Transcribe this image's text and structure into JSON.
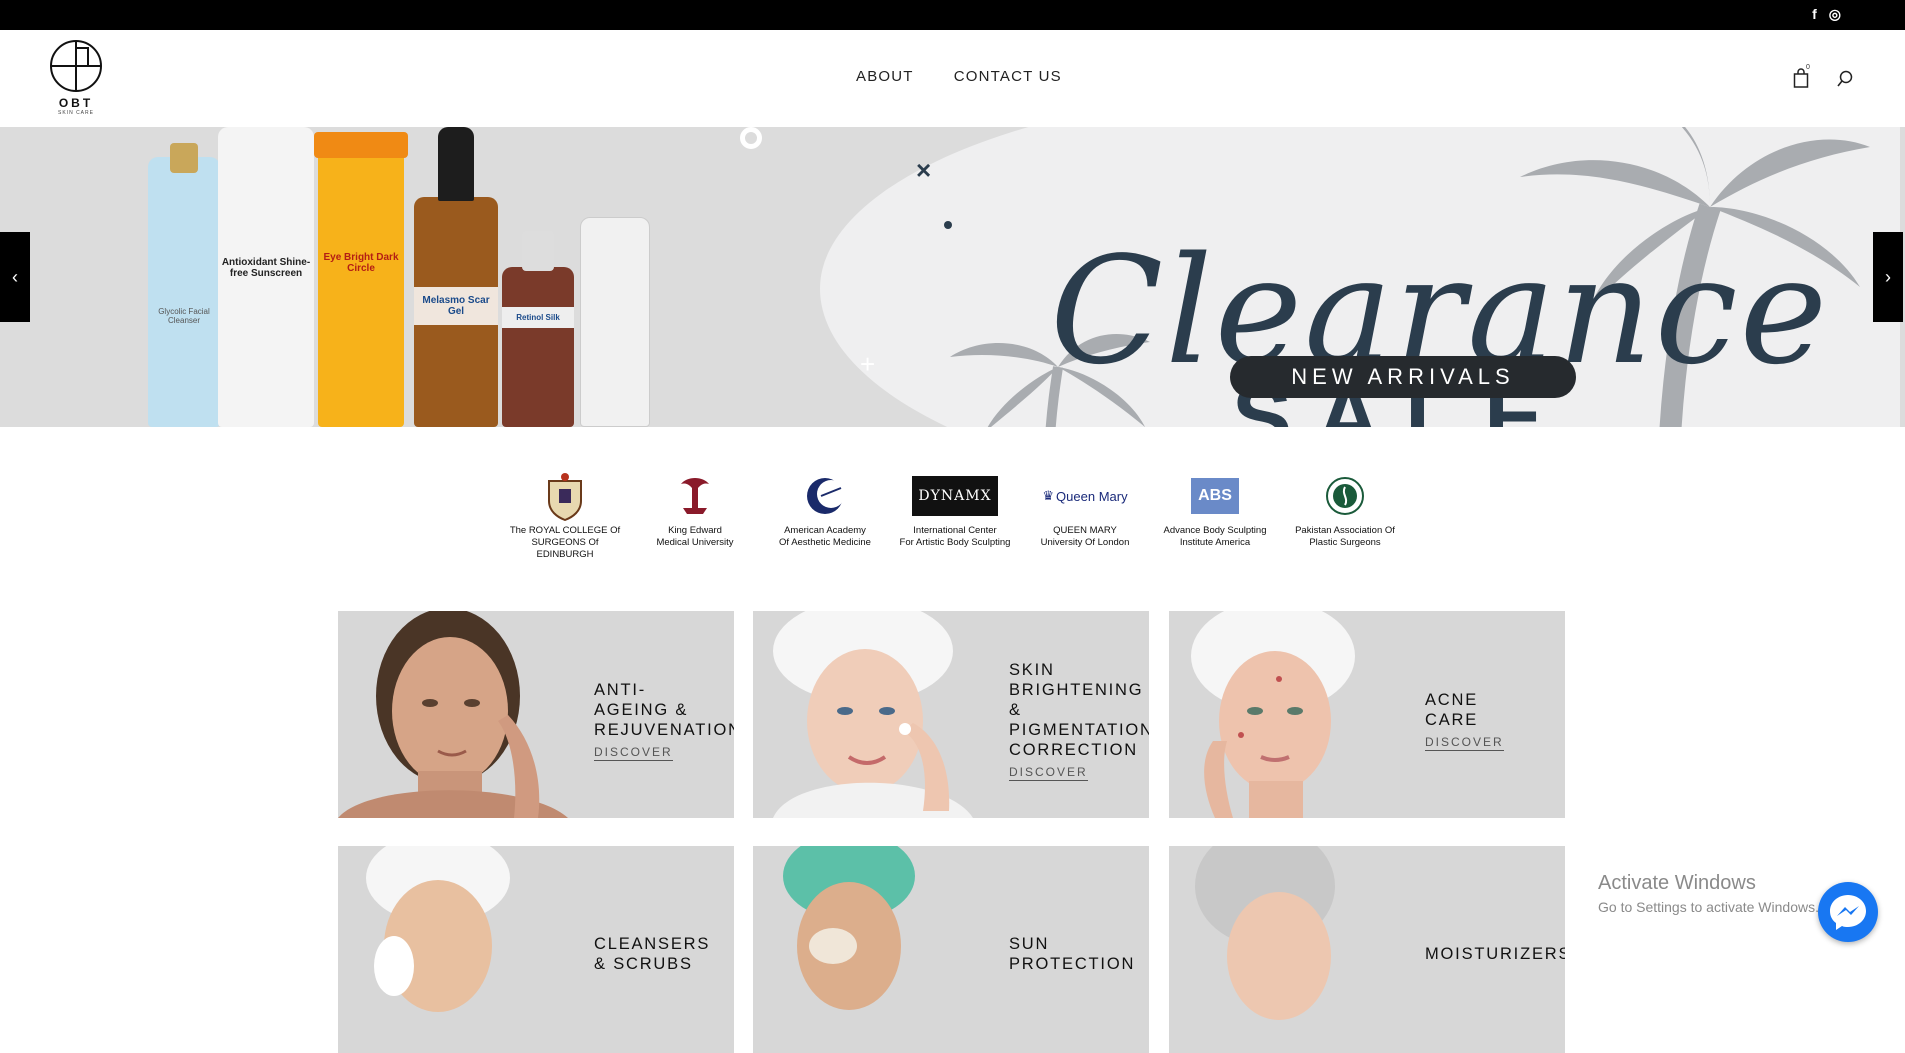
{
  "topbar": {
    "facebook": "f",
    "instagram": "◎"
  },
  "header": {
    "logo_word": "OBT",
    "logo_sub": "SKIN CARE",
    "nav": [
      "ABOUT",
      "CONTACT US"
    ],
    "cart_count": "0"
  },
  "banner": {
    "headline": "Clearance",
    "subheadline": "SALE",
    "button": "NEW ARRIVALS",
    "prev": "‹",
    "next": "›",
    "bottles": [
      "Glycolic Facial Cleanser",
      "Antioxidant Shine-free Sunscreen",
      "Eye Bright Dark Circle",
      "Melasmo Scar Gel",
      "Retinol Silk"
    ]
  },
  "partners": [
    {
      "name": "The ROYAL COLLEGE Of\nSURGEONS Of EDINBURGH"
    },
    {
      "name": "King Edward\nMedical University"
    },
    {
      "name": "American Academy\nOf Aesthetic Medicine"
    },
    {
      "name": "International Center\nFor Artistic Body Sculpting",
      "logo_text": "DYNAMX"
    },
    {
      "name": "QUEEN MARY\nUniversity Of London",
      "logo_text": "Queen Mary"
    },
    {
      "name": "Advance Body Sculpting\nInstitute America",
      "logo_text": "ABS"
    },
    {
      "name": "Pakistan Association Of\nPlastic Surgeons"
    }
  ],
  "categories": [
    {
      "title": "ANTI-\nAGEING &\nREJUVENATION",
      "cta": "DISCOVER"
    },
    {
      "title": "SKIN\nBRIGHTENING\n&\nPIGMENTATION\nCORRECTION",
      "cta": "DISCOVER"
    },
    {
      "title": "ACNE\nCARE",
      "cta": "DISCOVER"
    },
    {
      "title": "CLEANSERS\n& SCRUBS"
    },
    {
      "title": "SUN\nPROTECTION"
    },
    {
      "title": "MOISTURIZERS"
    }
  ],
  "overlay": {
    "activate_title": "Activate Windows",
    "activate_sub": "Go to Settings to activate Windows."
  }
}
